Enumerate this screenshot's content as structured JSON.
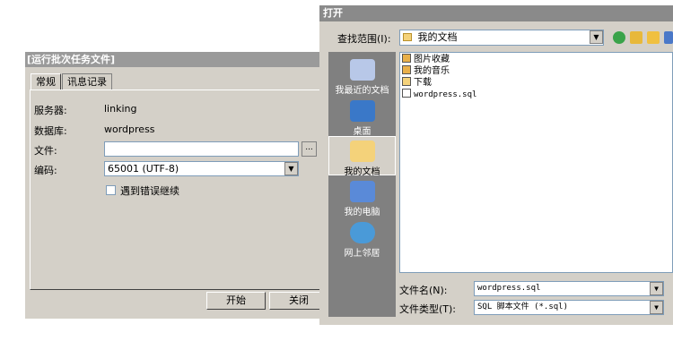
{
  "batch_dialog": {
    "title": "[运行批次任务文件]",
    "tabs": [
      "常规",
      "讯息记录"
    ],
    "server_label": "服务器:",
    "server_value": "linking",
    "database_label": "数据库:",
    "database_value": "wordpress",
    "file_label": "文件:",
    "file_value": "",
    "browse_label": "...",
    "encoding_label": "编码:",
    "encoding_value": "65001 (UTF-8)",
    "continue_on_error_label": "遇到错误继续",
    "continue_on_error_checked": false,
    "start_button": "开始",
    "close_button": "关闭"
  },
  "open_dialog": {
    "title": "打开",
    "look_in_label": "查找范围(I):",
    "look_in_value": "我的文档",
    "places": [
      {
        "label": "我最近的文档",
        "icon": "recent-documents-icon"
      },
      {
        "label": "桌面",
        "icon": "desktop-icon"
      },
      {
        "label": "我的文档",
        "icon": "my-documents-icon"
      },
      {
        "label": "我的电脑",
        "icon": "my-computer-icon"
      },
      {
        "label": "网上邻居",
        "icon": "network-places-icon"
      }
    ],
    "files": [
      {
        "name": "图片收藏",
        "icon": "folder-pictures-icon"
      },
      {
        "name": "我的音乐",
        "icon": "folder-music-icon"
      },
      {
        "name": "下载",
        "icon": "folder-icon"
      },
      {
        "name": "wordpress.sql",
        "icon": "sql-file-icon"
      }
    ],
    "filename_label": "文件名(N):",
    "filename_value": "wordpress.sql",
    "filetype_label": "文件类型(T):",
    "filetype_value": "SQL 脚本文件 (*.sql)"
  }
}
